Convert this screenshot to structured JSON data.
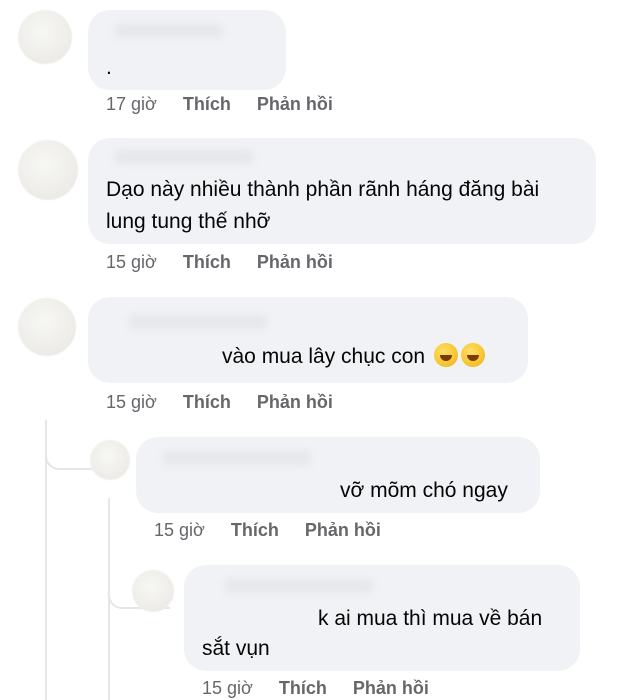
{
  "comments": [
    {
      "text": ".",
      "time": "17 giờ",
      "like": "Thích",
      "reply": "Phản hồi"
    },
    {
      "lines": [
        "Dạo này nhiều thành phần rãnh háng đăng bài",
        "lung tung thế nhỡ"
      ],
      "time": "15 giờ",
      "like": "Thích",
      "reply": "Phản hồi"
    },
    {
      "text": "vào mua lây chục con",
      "emoji": [
        "rolling-laughing-emoji",
        "rolling-laughing-emoji"
      ],
      "time": "15 giờ",
      "like": "Thích",
      "reply": "Phản hồi"
    },
    {
      "text": "vỡ mõm chó ngay",
      "time": "15 giờ",
      "like": "Thích",
      "reply": "Phản hồi"
    },
    {
      "lines": [
        "k ai mua thì mua về bán",
        "sắt vụn"
      ],
      "time": "15 giờ",
      "like": "Thích",
      "reply": "Phản hồi"
    }
  ]
}
